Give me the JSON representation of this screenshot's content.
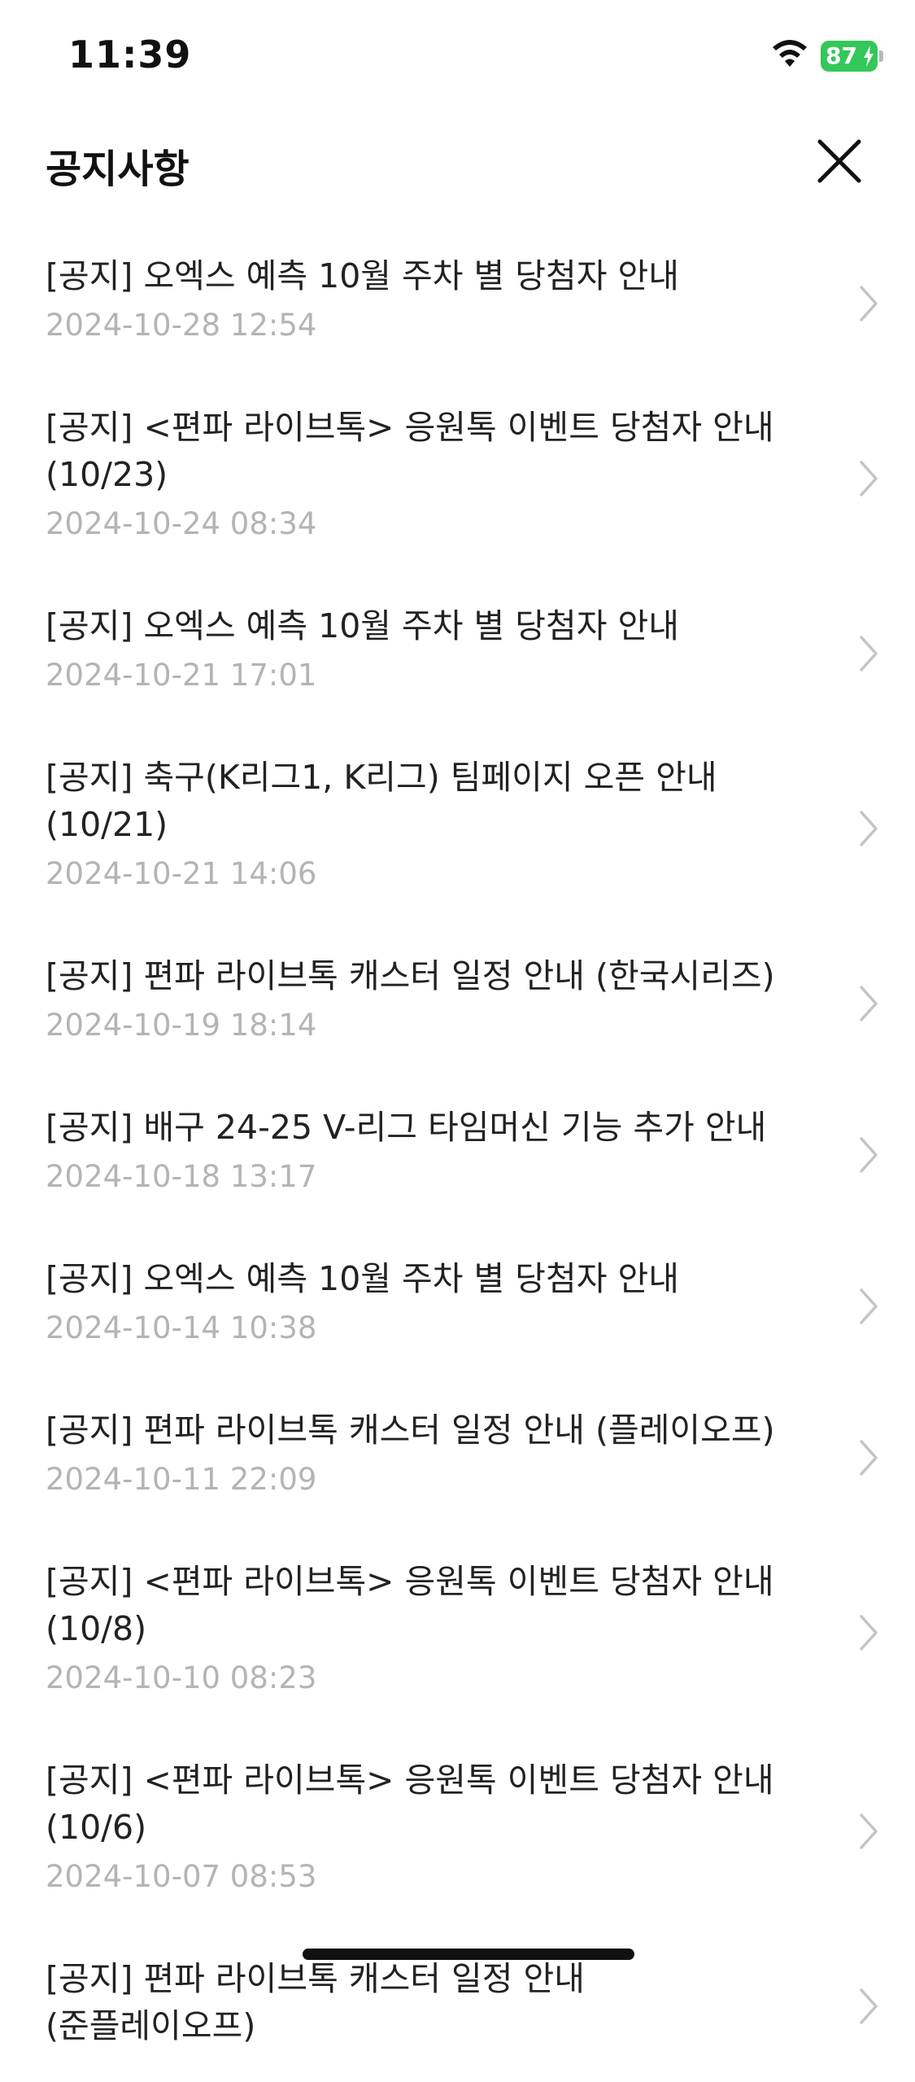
{
  "status_bar": {
    "time": "11:39",
    "battery": "87",
    "battery_color": "#34c759"
  },
  "header": {
    "title": "공지사항",
    "close_icon": "close-icon"
  },
  "notices": [
    {
      "title": "[공지] 오엑스 예측 10월 주차 별 당첨자 안내",
      "date": "2024-10-28 12:54"
    },
    {
      "title": "[공지] <편파 라이브톡> 응원톡 이벤트 당첨자 안내 (10/23)",
      "date": "2024-10-24 08:34"
    },
    {
      "title": "[공지] 오엑스 예측 10월 주차 별 당첨자 안내",
      "date": "2024-10-21 17:01"
    },
    {
      "title": "[공지] 축구(K리그1, K리그) 팀페이지 오픈 안내 (10/21)",
      "date": "2024-10-21 14:06"
    },
    {
      "title": "[공지] 편파 라이브톡 캐스터 일정 안내 (한국시리즈)",
      "date": "2024-10-19 18:14"
    },
    {
      "title": "[공지] 배구 24-25 V-리그 타임머신 기능 추가 안내",
      "date": "2024-10-18 13:17"
    },
    {
      "title": "[공지] 오엑스 예측 10월 주차 별 당첨자 안내",
      "date": "2024-10-14 10:38"
    },
    {
      "title": "[공지] 편파 라이브톡 캐스터 일정 안내 (플레이오프)",
      "date": "2024-10-11 22:09"
    },
    {
      "title": "[공지] <편파 라이브톡> 응원톡 이벤트 당첨자 안내 (10/8)",
      "date": "2024-10-10 08:23"
    },
    {
      "title": "[공지] <편파 라이브톡> 응원톡 이벤트 당첨자 안내 (10/6)",
      "date": "2024-10-07 08:53"
    },
    {
      "title": "[공지] 편파 라이브톡 캐스터 일정 안내 (준플레이오프)",
      "date": ""
    }
  ]
}
